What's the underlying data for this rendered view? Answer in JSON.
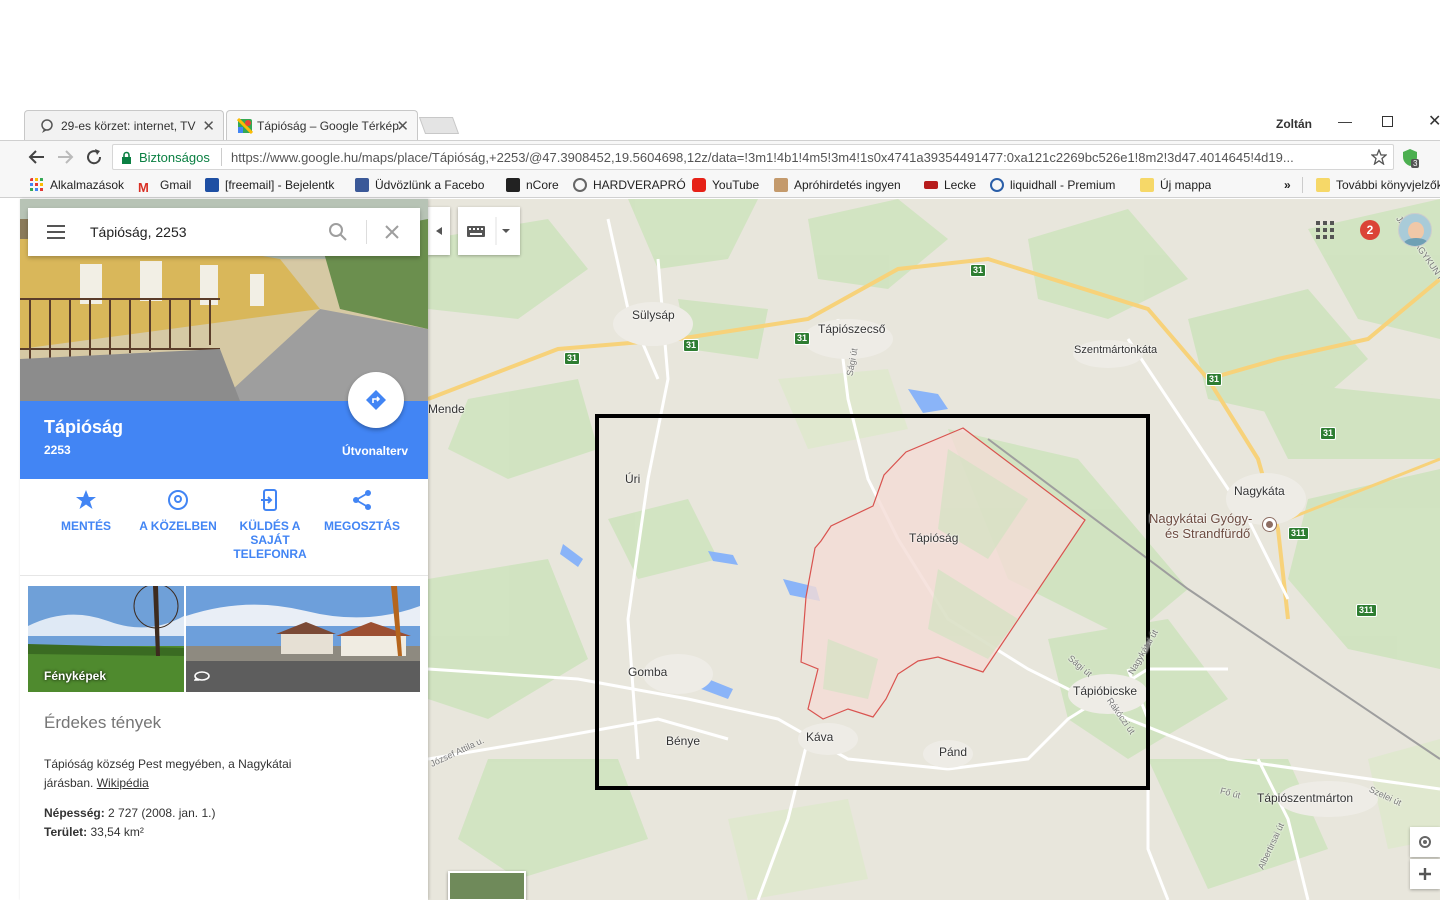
{
  "browser": {
    "user_name": "Zoltán",
    "tabs": [
      {
        "title": "29-es körzet: internet, TV",
        "active": false
      },
      {
        "title": "Tápióság – Google Térkép",
        "active": true
      }
    ],
    "security_label": "Biztonságos",
    "url": "https://www.google.hu/maps/place/Tápióság,+2253/@47.3908452,19.5604698,12z/data=!3m1!4b1!4m5!3m4!1s0x4741a39354491477:0xa121c2269bc526e1!8m2!3d47.4014645!4d19...",
    "extension_badge": "3",
    "bookmarks": [
      "Alkalmazások",
      "Gmail",
      "[freemail] - Bejelentk",
      "Üdvözlünk a Facebo",
      "nCore",
      "HARDVERAPRÓ",
      "YouTube",
      "Apróhirdetés ingyen",
      "Lecke",
      "liquidhall - Premium",
      "Új mappa"
    ],
    "bookmarks_more": "»",
    "other_bookmarks": "További könyvjelzők"
  },
  "search": {
    "value": "Tápióság, 2253"
  },
  "place": {
    "name": "Tápióság",
    "postal_code": "2253",
    "directions_label": "Útvonalterv",
    "actions": [
      {
        "label": "MENTÉS",
        "icon": "star-icon"
      },
      {
        "label": "A KÖZELBEN",
        "icon": "nearby-icon"
      },
      {
        "label": "KÜLDÉS A SAJÁT TELEFONRA",
        "icon": "send-to-phone-icon"
      },
      {
        "label": "MEGOSZTÁS",
        "icon": "share-icon"
      }
    ],
    "photos_label": "Fényképek",
    "facts_heading": "Érdekes tények",
    "description": "Tápióság község Pest megyében, a Nagykátai járásban.",
    "wiki_link": "Wikipédia",
    "population_label": "Népesség:",
    "population_value": "2 727 (2008. jan. 1.)",
    "area_label": "Terület:",
    "area_value": "33,54 km²"
  },
  "map": {
    "notification_count": "2",
    "places": [
      "Sülysáp",
      "Tápiószecső",
      "Szentmártonkáta",
      "Mende",
      "Úri",
      "Tápióság",
      "Nagykáta",
      "Nagykátai Gyógy-",
      "és Strandfürdő",
      "Gomba",
      "Tápióbicske",
      "Bénye",
      "Káva",
      "Pánd",
      "Tápiószentmárton"
    ],
    "roads": [
      "Sági út",
      "Sági út",
      "Nagykátai út",
      "Rákóczi út",
      "József Attila u.",
      "Fő út",
      "Albertirsai út",
      "Szelei út",
      "JÁSZ-NAGYKUN PEST"
    ],
    "route_shields": [
      "31",
      "31",
      "31",
      "31",
      "31",
      "31",
      "31",
      "311",
      "311"
    ],
    "colors": {
      "boundary": "#d9534f",
      "fill": "#f4dcd6",
      "highlight_box": "#000000",
      "blue": "#4285f4"
    }
  }
}
